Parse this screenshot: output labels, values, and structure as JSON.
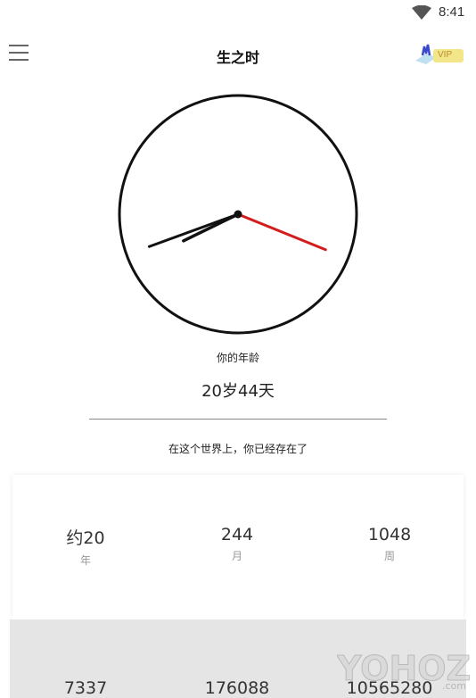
{
  "status_bar": {
    "time": "8:41",
    "wifi_icon": "wifi-icon"
  },
  "app_bar": {
    "title": "生之时",
    "menu_icon": "menu-icon",
    "vip_label": "VIP"
  },
  "clock": {
    "hour_hand_angle_deg": 244,
    "minute_hand_angle_deg": 250,
    "second_hand_angle_deg": 112,
    "second_hand_color": "#d31d1d",
    "hand_color": "#111111"
  },
  "age": {
    "label": "你的年龄",
    "value": "20岁44天"
  },
  "existence": {
    "label": "在这个世界上，你已经存在了"
  },
  "stats": [
    {
      "value": "约20",
      "unit": "年"
    },
    {
      "value": "244",
      "unit": "月"
    },
    {
      "value": "1048",
      "unit": "周"
    }
  ],
  "stats_row2": [
    {
      "value": "7337"
    },
    {
      "value": "176088"
    },
    {
      "value": "10565280"
    }
  ]
}
